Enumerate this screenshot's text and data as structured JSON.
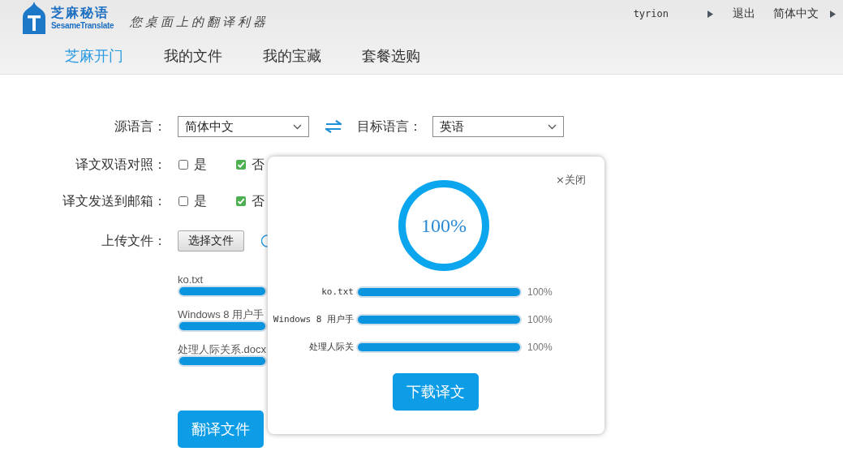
{
  "header": {
    "logo": {
      "title": "芝麻秘语",
      "subtitle": "SesameTranslate"
    },
    "tagline": "您桌面上的翻译利器",
    "user": "tyrion",
    "logout": "退出",
    "language": "简体中文"
  },
  "nav": [
    {
      "label": "芝麻开门",
      "selected": true
    },
    {
      "label": "我的文件",
      "selected": false
    },
    {
      "label": "我的宝藏",
      "selected": false
    },
    {
      "label": "套餐选购",
      "selected": false
    }
  ],
  "form": {
    "source": {
      "label": "源语言：",
      "value": "简体中文"
    },
    "target": {
      "label": "目标语言：",
      "value": "英语"
    },
    "options": [
      {
        "label": "译文双语对照：",
        "choices": [
          {
            "label": "是",
            "checked": false
          },
          {
            "label": "否",
            "checked": true
          }
        ]
      },
      {
        "label": "译文发送到邮箱：",
        "choices": [
          {
            "label": "是",
            "checked": false
          },
          {
            "label": "否",
            "checked": true
          }
        ]
      }
    ],
    "upload": {
      "label": "上传文件：",
      "button": "选择文件"
    },
    "files": [
      {
        "name": "ko.txt",
        "level": 1
      },
      {
        "name": "Windows 8 用户手",
        "level": 1
      },
      {
        "name": "处理人际关系.docx",
        "level": 1
      }
    ],
    "submit": "翻译文件"
  },
  "dialog": {
    "close": "×关闭",
    "overall": {
      "level": 1,
      "reading": "100%"
    },
    "files": [
      {
        "name": "ko.txt",
        "level": 1,
        "reading": "100%"
      },
      {
        "name": "Windows 8 用户手",
        "level": 1,
        "reading": "100%"
      },
      {
        "name": "处理人际关",
        "level": 1,
        "reading": "100%"
      }
    ],
    "download": "下载译文"
  }
}
